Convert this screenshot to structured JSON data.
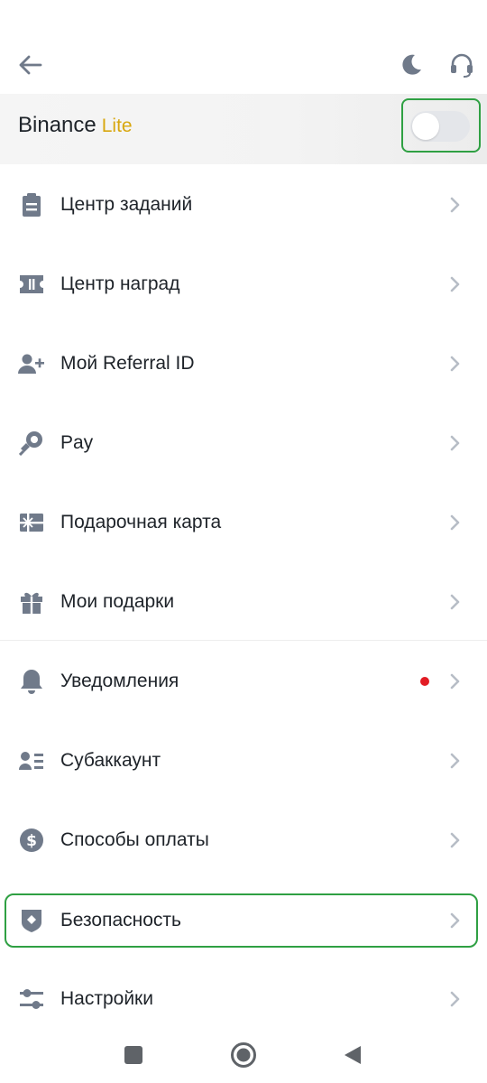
{
  "header": {
    "back_icon": "arrow-left-icon",
    "theme_icon": "moon-icon",
    "support_icon": "headset-icon"
  },
  "lite_banner": {
    "brand": "Binance",
    "mode": "Lite",
    "toggle_on": false
  },
  "menu": {
    "items": [
      {
        "label": "Центр заданий",
        "icon": "clipboard-icon"
      },
      {
        "label": "Центр наград",
        "icon": "ticket-icon"
      },
      {
        "label": "Мой Referral ID",
        "icon": "add-user-icon"
      },
      {
        "label": "Pay",
        "icon": "pay-icon"
      },
      {
        "label": "Подарочная карта",
        "icon": "gift-card-icon"
      },
      {
        "label": "Мои подарки",
        "icon": "gift-icon"
      },
      {
        "label": "Уведомления",
        "icon": "bell-icon"
      },
      {
        "label": "Субаккаунт",
        "icon": "id-card-icon"
      },
      {
        "label": "Способы оплаты",
        "icon": "dollar-icon"
      },
      {
        "label": "Безопасность",
        "icon": "shield-icon"
      },
      {
        "label": "Настройки",
        "icon": "sliders-icon"
      }
    ]
  },
  "colors": {
    "accent_yellow": "#d8a70f",
    "icon_gray": "#707a8a",
    "chevron_gray": "#b7bdc6",
    "notification_red": "#e21c24",
    "highlight_green": "#2fa043"
  },
  "nav": {
    "recent_icon": "square-icon",
    "home_icon": "circle-icon",
    "back_icon": "triangle-back-icon"
  }
}
